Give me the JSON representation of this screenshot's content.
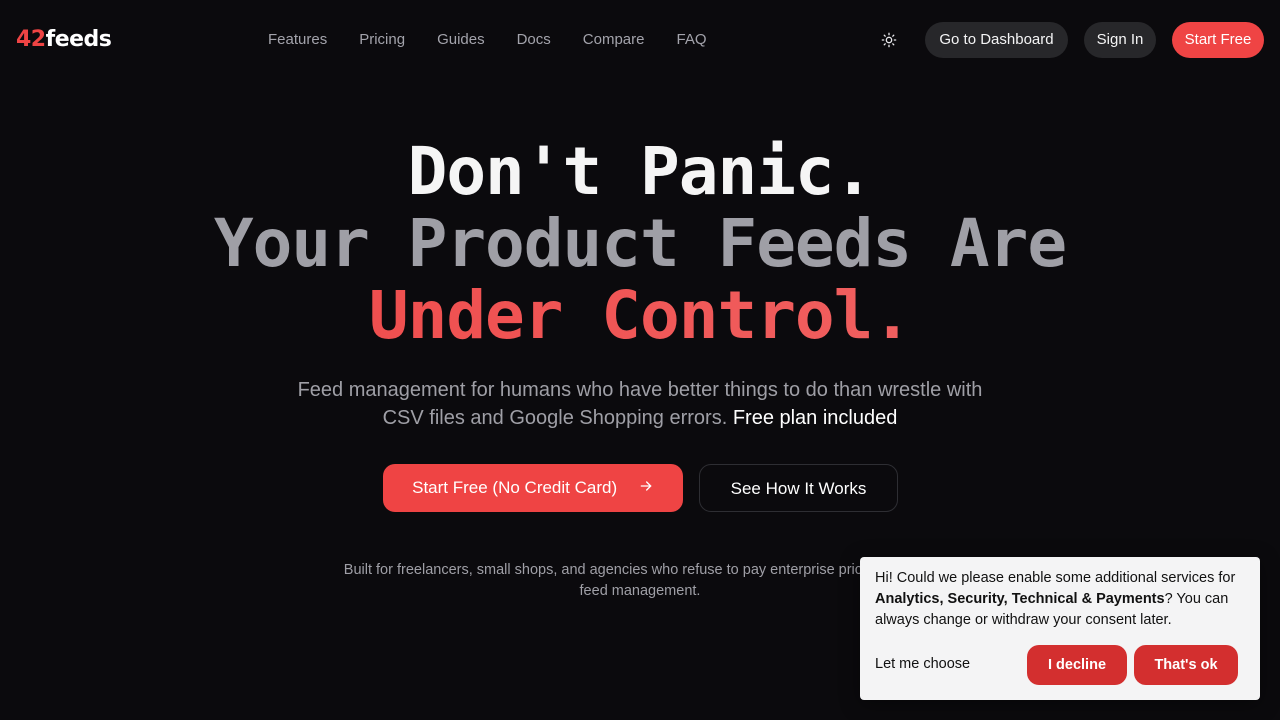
{
  "header": {
    "logo_num": "42",
    "logo_word": "feeds",
    "nav": [
      "Features",
      "Pricing",
      "Guides",
      "Docs",
      "Compare",
      "FAQ"
    ],
    "theme_icon": "sun-icon",
    "dashboard_label": "Go to Dashboard",
    "signin_label": "Sign In",
    "startfree_label": "Start Free"
  },
  "hero": {
    "line1": "Don't Panic.",
    "line2": "Your Product Feeds Are",
    "line3": "Under Control.",
    "subtitle": "Feed management for humans who have better things to do than wrestle with CSV files and Google Shopping errors.",
    "subtitle_strong": "Free plan included",
    "cta_primary": "Start Free (No Credit Card)",
    "cta_primary_icon": "arrow-right-icon",
    "cta_secondary": "See How It Works",
    "built_for": "Built for freelancers, small shops, and agencies who refuse to pay enterprise prices for basic feed management."
  },
  "cookie": {
    "text_before": "Hi! Could we please enable some additional services for ",
    "text_bold": "Analytics, Security, Technical & Payments",
    "text_after": "? You can always change or withdraw your consent later.",
    "choose_label": "Let me choose",
    "decline_label": "I decline",
    "ok_label": "That's ok"
  },
  "colors": {
    "background": "#0b0a0d",
    "accent": "#ef4444",
    "cookie_button": "#d32f2f"
  }
}
